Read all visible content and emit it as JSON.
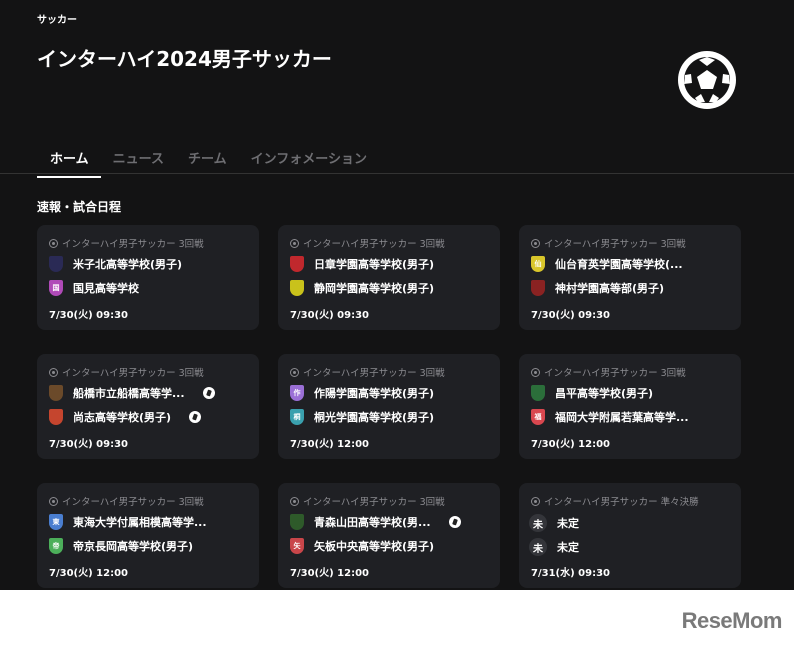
{
  "header": {
    "category": "サッカー",
    "title": "インターハイ2024男子サッカー"
  },
  "tabs": [
    {
      "label": "ホーム",
      "active": true
    },
    {
      "label": "ニュース"
    },
    {
      "label": "チーム"
    },
    {
      "label": "インフォメーション"
    }
  ],
  "section_title": "速報・試合日程",
  "matches": [
    {
      "round": "インターハイ男子サッカー 3回戦",
      "home": "米子北高等学校(男子)",
      "home_crest": "",
      "home_color": "#2a2a55",
      "away": "国見高等学校",
      "away_crest": "国",
      "away_color": "#b04ab8",
      "datetime": "7/30(火) 09:30"
    },
    {
      "round": "インターハイ男子サッカー 3回戦",
      "home": "日章学園高等学校(男子)",
      "home_crest": "",
      "home_color": "#c0282d",
      "away": "静岡学園高等学校(男子)",
      "away_crest": "",
      "away_color": "#c9c21b",
      "datetime": "7/30(火) 09:30"
    },
    {
      "round": "インターハイ男子サッカー 3回戦",
      "home": "仙台育英学園高等学校(...",
      "home_crest": "仙",
      "home_color": "#d9c62b",
      "away": "神村学園高等部(男子)",
      "away_crest": "",
      "away_color": "#8a2222",
      "datetime": "7/30(火) 09:30"
    },
    {
      "round": "インターハイ男子サッカー 3回戦",
      "home": "船橋市立船橋高等学...",
      "home_crest": "",
      "home_color": "#6b4a2a",
      "away": "尚志高等学校(男子)",
      "away_crest": "",
      "away_color": "#c5452e",
      "datetime": "7/30(火) 09:30"
    },
    {
      "round": "インターハイ男子サッカー 3回戦",
      "home": "作陽学園高等学校(男子)",
      "home_crest": "作",
      "home_color": "#9a6fd6",
      "away": "桐光学園高等学校(男子)",
      "away_crest": "桐",
      "away_color": "#3aa0ae",
      "datetime": "7/30(火) 12:00"
    },
    {
      "round": "インターハイ男子サッカー 3回戦",
      "home": "昌平高等学校(男子)",
      "home_crest": "",
      "home_color": "#2b6e3a",
      "away": "福岡大学附属若葉高等学...",
      "away_crest": "福",
      "away_color": "#d9474f",
      "datetime": "7/30(火) 12:00"
    },
    {
      "round": "インターハイ男子サッカー 3回戦",
      "home": "東海大学付属相模高等学...",
      "home_crest": "東",
      "home_color": "#4a7ed0",
      "away": "帝京長岡高等学校(男子)",
      "away_crest": "帝",
      "away_color": "#4caf5a",
      "datetime": "7/30(火) 12:00"
    },
    {
      "round": "インターハイ男子サッカー 3回戦",
      "home": "青森山田高等学校(男...",
      "home_crest": "",
      "home_color": "#2e5a2a",
      "away": "矢板中央高等学校(男子)",
      "away_crest": "矢",
      "away_color": "#c9464a",
      "datetime": "7/30(火) 12:00"
    },
    {
      "round": "インターハイ男子サッカー 準々決勝",
      "home": "未定",
      "home_crest": "未",
      "home_color": "#34353a",
      "away": "未定",
      "away_crest": "未",
      "away_color": "#34353a",
      "datetime": "7/31(水) 09:30"
    }
  ],
  "watermark": "ReseMom"
}
